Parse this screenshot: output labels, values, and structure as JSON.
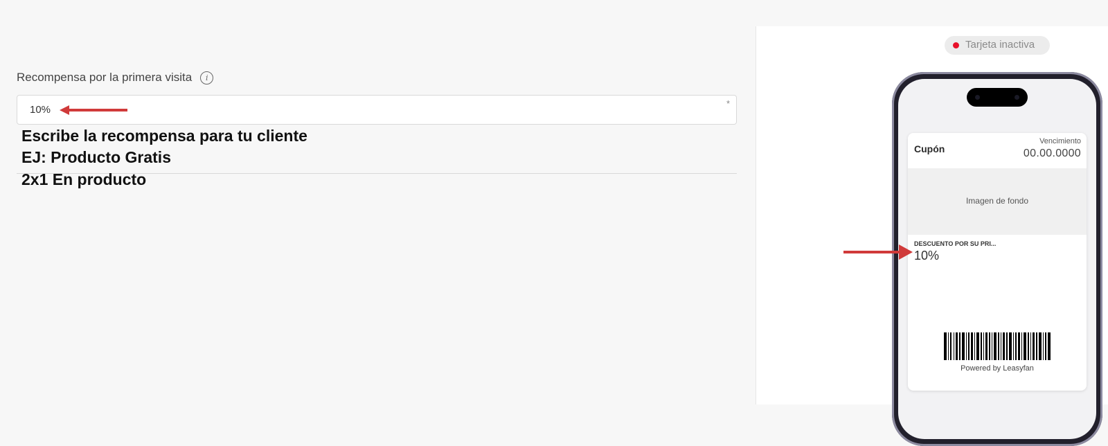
{
  "form": {
    "label": "Recompensa por la primera visita",
    "info_icon": "info-icon",
    "input_value": "10%",
    "required_mark": "*"
  },
  "annotation": {
    "lines": [
      "Escribe la recompensa para tu cliente",
      "EJ: Producto Gratis",
      "2x1 En producto"
    ],
    "arrow_color": "#d03a3a"
  },
  "preview": {
    "status_text": "Tarjeta inactiva",
    "status_color": "#e8102a",
    "card": {
      "title": "Cupón",
      "expiry_label": "Vencimiento",
      "expiry_value": "00.00.0000",
      "background_label": "Imagen de fondo",
      "discount_label": "DESCUENTO POR SU PRI...",
      "discount_value": "10%",
      "powered_by": "Powered by Leasyfan"
    }
  }
}
